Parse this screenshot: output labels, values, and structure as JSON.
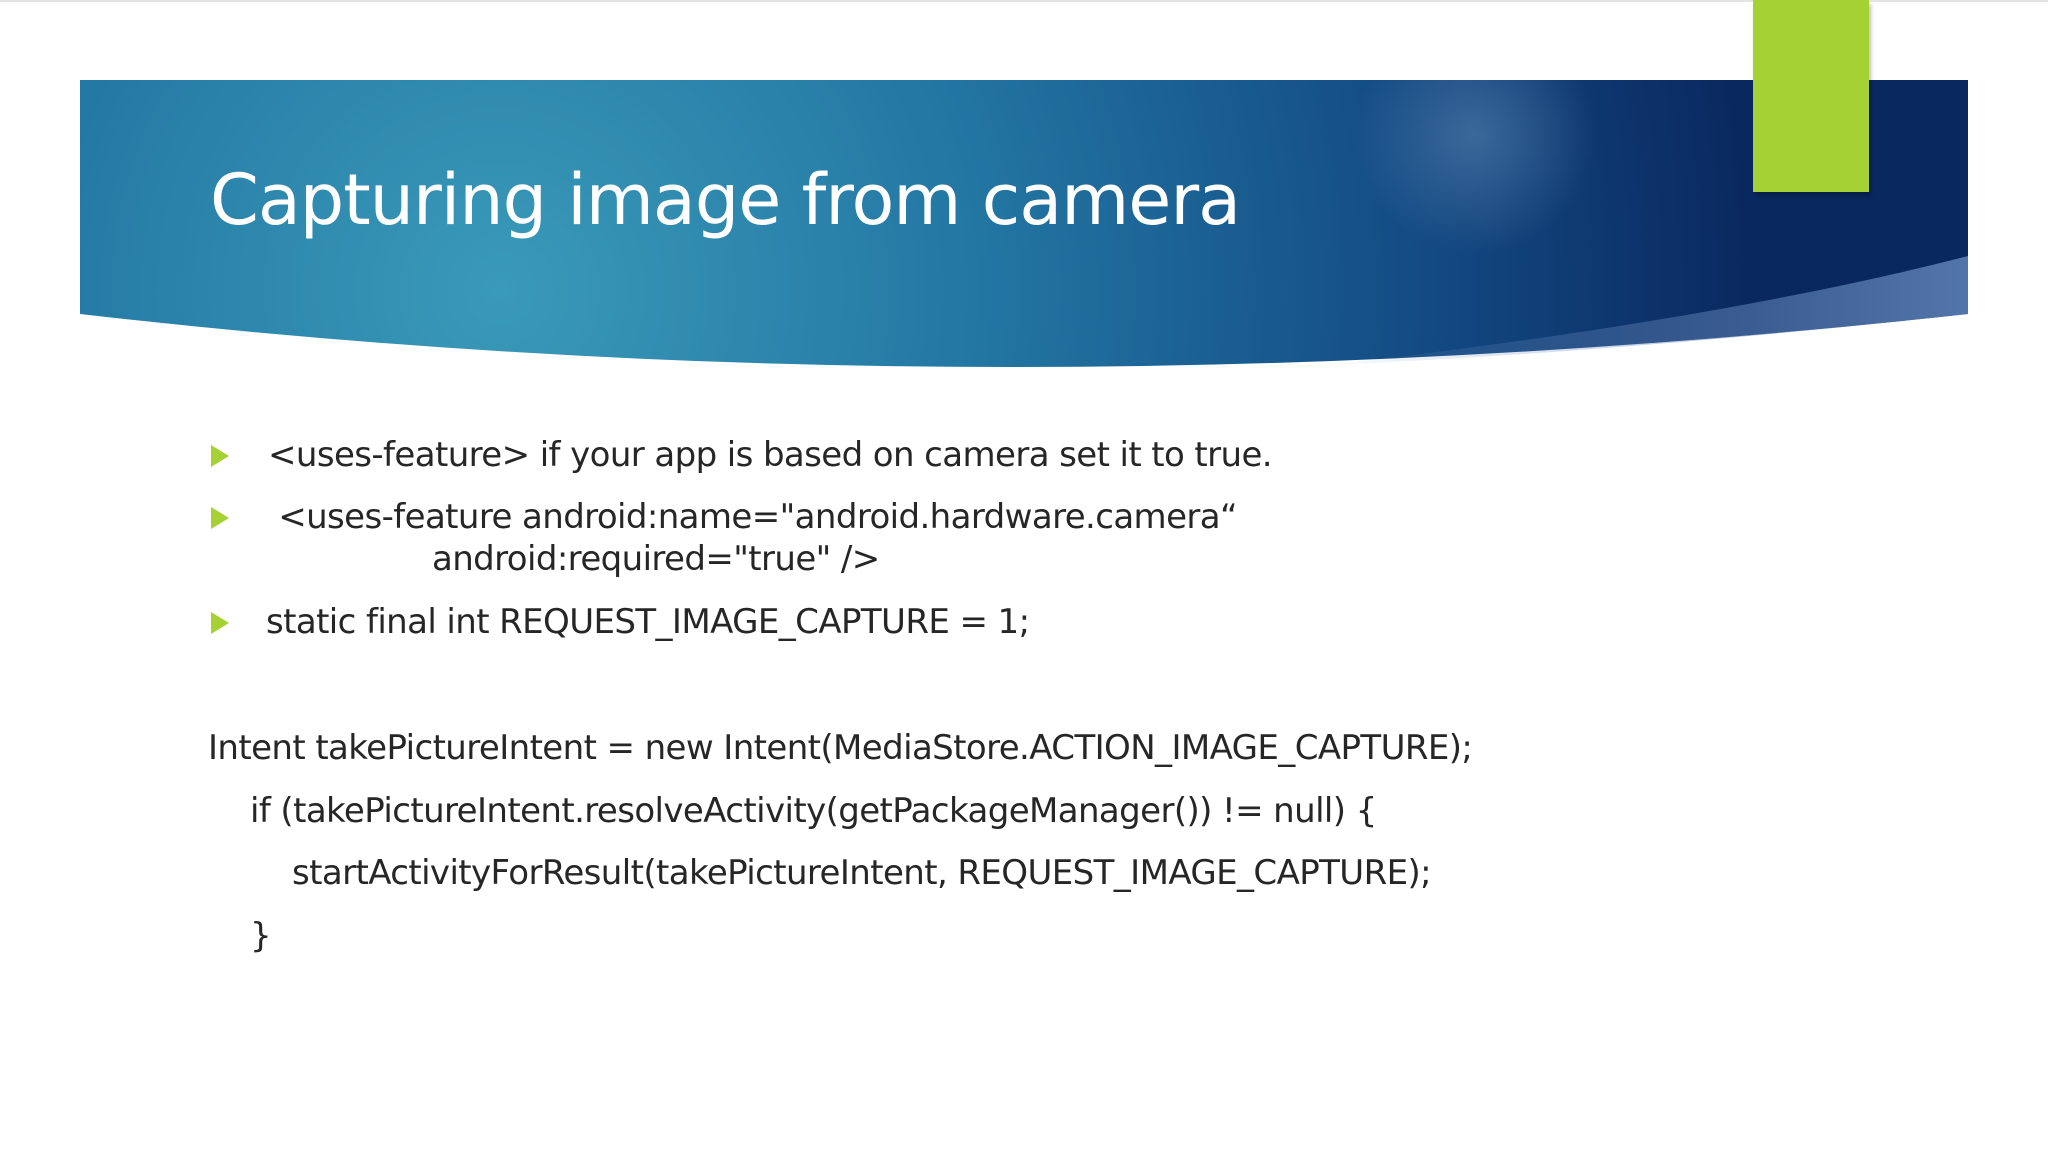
{
  "slide": {
    "title": "Capturing image from camera",
    "bullets": [
      {
        "lines": [
          "<uses-feature> if your app is based on camera set it to true."
        ]
      },
      {
        "lines": [
          " <uses-feature android:name=\"android.hardware.camera“",
          "android:required=\"true\" />"
        ]
      },
      {
        "lines": [
          "static final int REQUEST_IMAGE_CAPTURE = 1;"
        ]
      }
    ],
    "code": [
      "Intent takePictureIntent = new Intent(MediaStore.ACTION_IMAGE_CAPTURE);",
      "if (takePictureIntent.resolveActivity(getPackageManager()) != null) {",
      "startActivityForResult(takePictureIntent, REQUEST_IMAGE_CAPTURE);",
      "}"
    ]
  },
  "icons": {
    "bullet": "triangle-bullet-icon"
  },
  "colors": {
    "header_dark": "#0b2a62",
    "header_mid": "#1f6a99",
    "header_light": "#3696b8",
    "accent_green": "#a6d134",
    "title_text": "#ffffff",
    "body_text": "#262626"
  }
}
